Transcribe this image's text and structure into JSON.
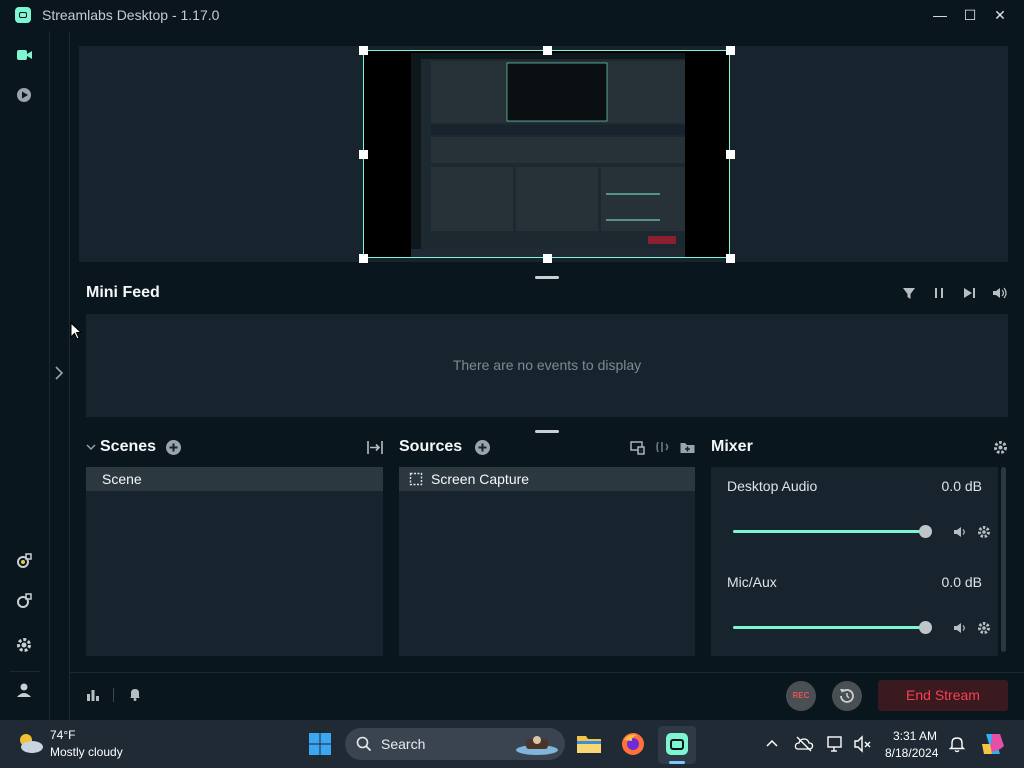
{
  "window": {
    "title": "Streamlabs Desktop - 1.17.0"
  },
  "mini_feed": {
    "title": "Mini Feed",
    "empty_text": "There are no events to display"
  },
  "scenes": {
    "title": "Scenes",
    "items": [
      "Scene"
    ]
  },
  "sources": {
    "title": "Sources",
    "items": [
      "Screen Capture"
    ]
  },
  "mixer": {
    "title": "Mixer",
    "channels": [
      {
        "name": "Desktop Audio",
        "level": "0.0 dB",
        "volume_fraction": 1.0
      },
      {
        "name": "Mic/Aux",
        "level": "0.0 dB",
        "volume_fraction": 1.0
      }
    ]
  },
  "controls": {
    "rec_label": "REC",
    "end_stream_label": "End Stream"
  },
  "taskbar": {
    "weather_temp": "74°F",
    "weather_desc": "Mostly cloudy",
    "search_label": "Search",
    "time": "3:31 AM",
    "date": "8/18/2024"
  },
  "colors": {
    "accent": "#80f5d2",
    "danger": "#fc3e57",
    "panel": "#17242d",
    "background": "#09161d"
  }
}
